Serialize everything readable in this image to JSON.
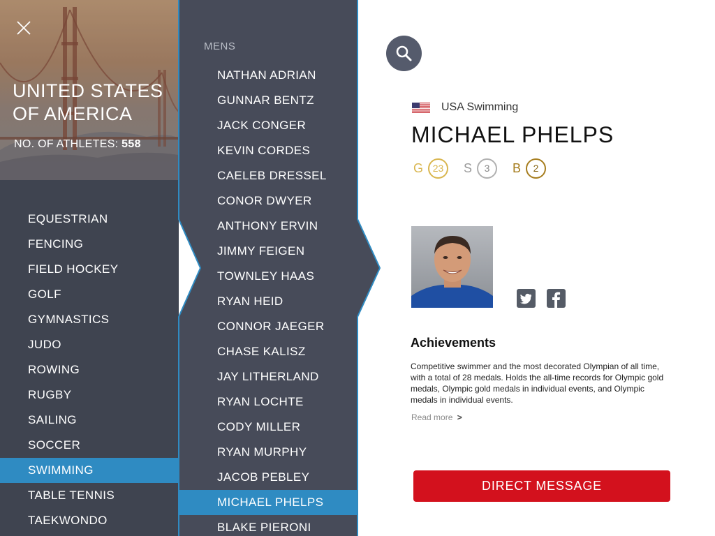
{
  "header": {
    "close_icon": "close-icon",
    "country_name": "UNITED STATES OF AMERICA",
    "athletes_label": "NO. OF ATHLETES:",
    "athletes_count": "558"
  },
  "sports": {
    "items": [
      {
        "label": "EQUESTRIAN"
      },
      {
        "label": "FENCING"
      },
      {
        "label": "FIELD HOCKEY"
      },
      {
        "label": "GOLF"
      },
      {
        "label": "GYMNASTICS"
      },
      {
        "label": "JUDO"
      },
      {
        "label": "ROWING"
      },
      {
        "label": "RUGBY"
      },
      {
        "label": "SAILING"
      },
      {
        "label": "SOCCER"
      },
      {
        "label": "SWIMMING"
      },
      {
        "label": "TABLE TENNIS"
      },
      {
        "label": "TAEKWONDO"
      }
    ],
    "selected_index": 10
  },
  "athletes": {
    "heading": "MENS",
    "items": [
      {
        "name": "NATHAN ADRIAN"
      },
      {
        "name": "GUNNAR BENTZ"
      },
      {
        "name": "JACK CONGER"
      },
      {
        "name": "KEVIN CORDES"
      },
      {
        "name": "CAELEB DRESSEL"
      },
      {
        "name": "CONOR DWYER"
      },
      {
        "name": "ANTHONY ERVIN"
      },
      {
        "name": "JIMMY FEIGEN"
      },
      {
        "name": "TOWNLEY HAAS"
      },
      {
        "name": "RYAN HEID"
      },
      {
        "name": "CONNOR JAEGER"
      },
      {
        "name": "CHASE KALISZ"
      },
      {
        "name": "JAY LITHERLAND"
      },
      {
        "name": "RYAN LOCHTE"
      },
      {
        "name": "CODY MILLER"
      },
      {
        "name": "RYAN MURPHY"
      },
      {
        "name": "JACOB PEBLEY"
      },
      {
        "name": "MICHAEL PHELPS"
      },
      {
        "name": "BLAKE PIERONI"
      }
    ],
    "selected_index": 17
  },
  "detail": {
    "search_icon": "search-icon",
    "team": "USA Swimming",
    "flag_icon": "us-flag-icon",
    "name": "MICHAEL PHELPS",
    "medals": {
      "gold": {
        "letter": "G",
        "count": "23",
        "color": "#d9b64f"
      },
      "silver": {
        "letter": "S",
        "count": "3",
        "color": "#a8a8a8"
      },
      "bronze": {
        "letter": "B",
        "count": "2",
        "color": "#a67d1e"
      }
    },
    "social": {
      "twitter_icon": "twitter-icon",
      "facebook_icon": "facebook-icon"
    },
    "achievements_title": "Achievements",
    "achievements_text": "Competitive swimmer and the most decorated Olympian of all time, with a total of 28 medals. Holds the all-time records for Olympic gold medals, Olympic gold medals in individual events, and Olympic medals in individual events.",
    "read_more": "Read more",
    "read_more_chevron": ">",
    "dm_button": "DIRECT MESSAGE"
  },
  "colors": {
    "panel": "#3f4450",
    "selected": "#2f8bc2",
    "accent_red": "#d3111d",
    "search_button": "#555b6c"
  }
}
